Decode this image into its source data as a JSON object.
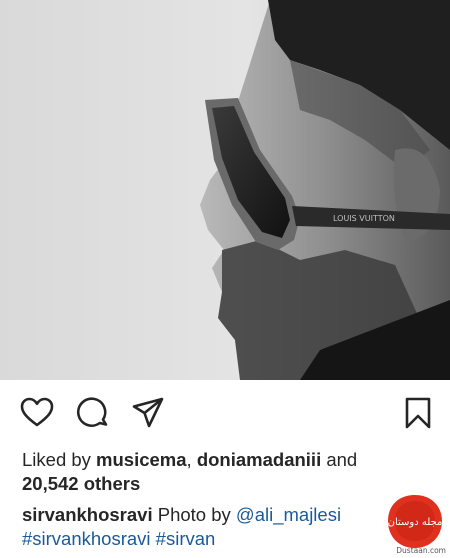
{
  "post": {
    "liked_by_prefix": "Liked by",
    "liked_user_1": "musicema",
    "liked_sep": ",",
    "liked_user_2": "doniamadaniii",
    "liked_and": "and",
    "others_count": "20,542 others",
    "caption_username": "sirvankhosravi",
    "caption_text": "Photo by",
    "caption_mention": "@ali_majlesi",
    "hashtag_1": "#sirvankhosravi",
    "hashtag_2": "#sirvan"
  },
  "photo": {
    "glasses_brand": "LOUIS VUITTON"
  },
  "watermark": {
    "site": "Dustaan.com",
    "logo_text": "مجله دوستان"
  },
  "icons": {
    "like": "heart-icon",
    "comment": "comment-icon",
    "share": "paper-plane-icon",
    "save": "bookmark-icon"
  }
}
